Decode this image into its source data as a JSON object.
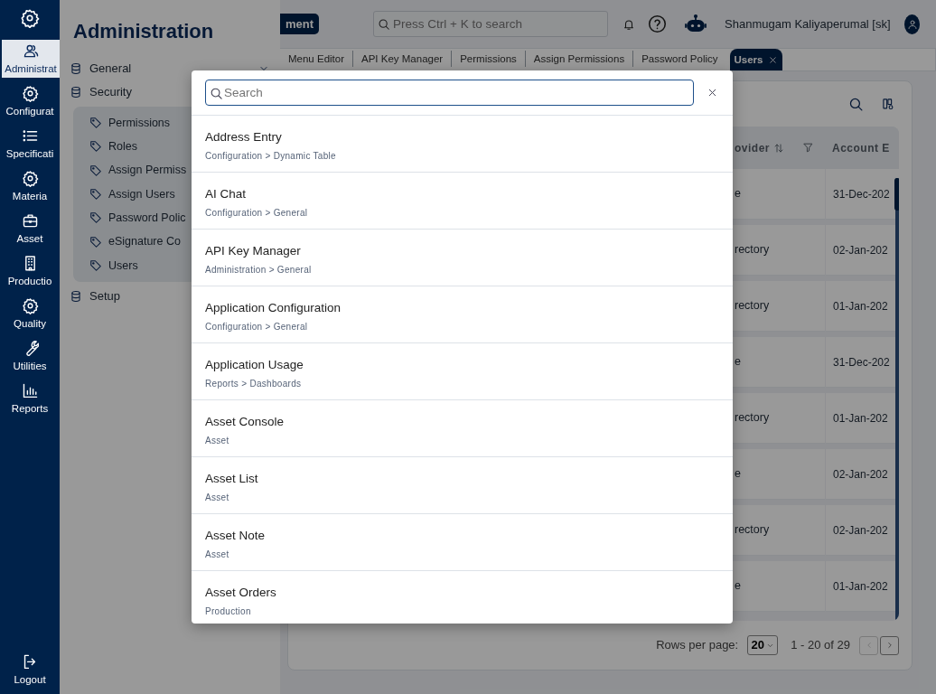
{
  "rail": {
    "items": [
      {
        "label": "Administrat",
        "selected": true
      },
      {
        "label": "Configurat",
        "selected": false
      },
      {
        "label": "Specificati",
        "selected": false
      },
      {
        "label": "Materia",
        "selected": false
      },
      {
        "label": "Asset",
        "selected": false
      },
      {
        "label": "Productio",
        "selected": false
      },
      {
        "label": "Quality",
        "selected": false
      },
      {
        "label": "Utilities",
        "selected": false
      },
      {
        "label": "Reports",
        "selected": false
      }
    ],
    "logout": "Logout"
  },
  "flyout": {
    "title": "Administration",
    "groups": [
      {
        "label": "General",
        "expanded": false
      },
      {
        "label": "Security",
        "expanded": true,
        "children": [
          {
            "label": "Permissions"
          },
          {
            "label": "Roles"
          },
          {
            "label": "Assign Permiss"
          },
          {
            "label": "Assign Users"
          },
          {
            "label": "Password Polic"
          },
          {
            "label": "eSignature Co"
          },
          {
            "label": "Users"
          }
        ]
      },
      {
        "label": "Setup",
        "expanded": false
      }
    ]
  },
  "topbar": {
    "badge": "ment",
    "search": {
      "placeholder": "Press Ctrl + K to search"
    },
    "user": "Shanmugam Kaliyaperumal [sk]"
  },
  "tabs": [
    {
      "label": "Menu Editor",
      "selected": false
    },
    {
      "label": "API Key Manager",
      "selected": false
    },
    {
      "label": "Permissions",
      "selected": false
    },
    {
      "label": "Assign Permissions",
      "selected": false
    },
    {
      "label": "Password Policy",
      "selected": false
    },
    {
      "label": "Users",
      "selected": true
    }
  ],
  "table": {
    "columns": [
      {
        "label": "ovider"
      },
      {
        "label": "Account E"
      }
    ],
    "rows": [
      [
        "e",
        "31-Dec-202"
      ],
      [
        "rectory",
        "02-Jan-202"
      ],
      [
        "rectory",
        "01-Jan-202"
      ],
      [
        "e",
        "31-Dec-202"
      ],
      [
        "rectory",
        "01-Jan-202"
      ],
      [
        "e",
        "02-Jan-202"
      ],
      [
        "rectory",
        "02-Jan-202"
      ],
      [
        "e",
        "01-Jan-202"
      ]
    ]
  },
  "pagination": {
    "label": "Rows per page:",
    "page_size": "20",
    "range": "1 - 20 of 29",
    "prev_disabled": true,
    "next_disabled": false
  },
  "modal": {
    "search": {
      "placeholder": "Search"
    },
    "results": [
      {
        "title": "Address Entry",
        "path": "Configuration > Dynamic Table"
      },
      {
        "title": "AI Chat",
        "path": "Configuration > General"
      },
      {
        "title": "API Key Manager",
        "path": "Administration > General"
      },
      {
        "title": "Application Configuration",
        "path": "Configuration > General"
      },
      {
        "title": "Application Usage",
        "path": "Reports > Dashboards"
      },
      {
        "title": "Asset Console",
        "path": "Asset"
      },
      {
        "title": "Asset List",
        "path": "Asset"
      },
      {
        "title": "Asset Note",
        "path": "Asset"
      },
      {
        "title": "Asset Orders",
        "path": "Production"
      }
    ]
  }
}
